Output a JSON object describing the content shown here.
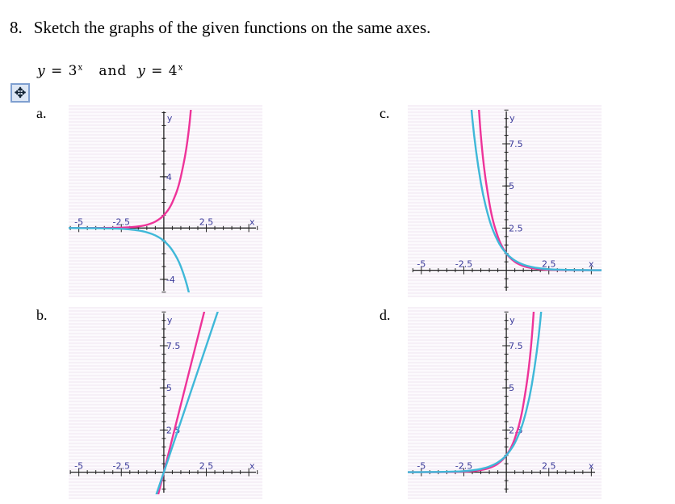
{
  "question": {
    "number": "8.",
    "text": "Sketch the graphs of the given functions on the same axes."
  },
  "equation": {
    "left_y": "y",
    "left_eq": " = 3",
    "left_exp": "x",
    "and": "and",
    "right_y": "y",
    "right_eq": " = 4",
    "right_exp": "x"
  },
  "move_icon": "move-arrows-icon",
  "colors": {
    "pink": "#ee3399",
    "blue": "#3fb8d8",
    "axis": "#222222",
    "label": "#3a3a9a"
  },
  "chart_data": [
    {
      "id": "a",
      "option_label": "a.",
      "type": "line",
      "x_ticks": [
        "-5",
        "-2.5",
        "2.5"
      ],
      "x_tick_values": [
        -5,
        -2.5,
        2.5
      ],
      "y_ticks": [
        "4",
        "-4"
      ],
      "y_tick_values": [
        4,
        -4
      ],
      "xlabel": "x",
      "ylabel": "y",
      "xlim": [
        -5.6,
        5.8
      ],
      "ylim": [
        -5.4,
        9.6
      ],
      "series": [
        {
          "color": "pink",
          "x": [
            -6,
            -5,
            -4,
            -3,
            -2.5,
            -2,
            -1.5,
            -1,
            -0.5,
            0,
            0.5,
            1,
            1.5,
            2
          ],
          "y": [
            0,
            0.001,
            0.004,
            0.016,
            0.031,
            0.063,
            0.125,
            0.25,
            0.5,
            1,
            2,
            4,
            8,
            16
          ]
        },
        {
          "color": "blue",
          "x": [
            -6,
            -5,
            -4,
            -3,
            -2.5,
            -2,
            -1.5,
            -1,
            -0.5,
            0,
            0.5,
            1,
            1.5,
            2,
            2.5
          ],
          "y": [
            0,
            -0.004,
            -0.012,
            -0.037,
            -0.064,
            -0.111,
            -0.192,
            -0.333,
            -0.577,
            -1,
            -1.732,
            -3,
            -5.196,
            -9,
            -15.59
          ]
        }
      ]
    },
    {
      "id": "b",
      "option_label": "b.",
      "type": "line",
      "x_ticks": [
        "-5",
        "-2.5",
        "2.5"
      ],
      "x_tick_values": [
        -5,
        -2.5,
        2.5
      ],
      "y_ticks": [
        "7.5",
        "5",
        "2.5"
      ],
      "y_tick_values": [
        7.5,
        5,
        2.5
      ],
      "xlabel": "x",
      "ylabel": "y",
      "xlim": [
        -5.6,
        5.8
      ],
      "ylim": [
        -1.6,
        9.8
      ],
      "series": [
        {
          "color": "pink",
          "x": [
            -0.4,
            2.6
          ],
          "y": [
            -1.6,
            10.4
          ]
        },
        {
          "color": "blue",
          "x": [
            -0.5,
            3.4
          ],
          "y": [
            -1.5,
            10.2
          ]
        }
      ]
    },
    {
      "id": "c",
      "option_label": "c.",
      "type": "line",
      "x_ticks": [
        "-5",
        "-2.5",
        "2.5"
      ],
      "x_tick_values": [
        -5,
        -2.5,
        2.5
      ],
      "y_ticks": [
        "7.5",
        "5",
        "2.5"
      ],
      "y_tick_values": [
        7.5,
        5,
        2.5
      ],
      "xlabel": "x",
      "ylabel": "y",
      "xlim": [
        -5.8,
        5.6
      ],
      "ylim": [
        -1.6,
        9.8
      ],
      "series": [
        {
          "color": "pink",
          "x": [
            -2,
            -1.5,
            -1,
            -0.5,
            0,
            0.5,
            1,
            1.5,
            2,
            2.5,
            3,
            4,
            5,
            6
          ],
          "y": [
            16,
            8,
            4,
            2,
            1,
            0.5,
            0.25,
            0.125,
            0.063,
            0.031,
            0.016,
            0.004,
            0.001,
            0
          ]
        },
        {
          "color": "blue",
          "x": [
            -2.5,
            -2,
            -1.5,
            -1,
            -0.5,
            0,
            0.5,
            1,
            1.5,
            2,
            2.5,
            3,
            4,
            5,
            6
          ],
          "y": [
            15.59,
            9,
            5.196,
            3,
            1.732,
            1,
            0.577,
            0.333,
            0.192,
            0.111,
            0.064,
            0.037,
            0.012,
            0.004,
            0
          ]
        }
      ]
    },
    {
      "id": "d",
      "option_label": "d.",
      "type": "line",
      "x_ticks": [
        "-5",
        "-2.5",
        "2.5"
      ],
      "x_tick_values": [
        -5,
        -2.5,
        2.5
      ],
      "y_ticks": [
        "7.5",
        "5",
        "2.5"
      ],
      "y_tick_values": [
        7.5,
        5,
        2.5
      ],
      "xlabel": "x",
      "ylabel": "y",
      "xlim": [
        -5.8,
        5.6
      ],
      "ylim": [
        -1.6,
        9.8
      ],
      "series": [
        {
          "color": "pink",
          "x": [
            -6,
            -5,
            -4,
            -3,
            -2.5,
            -2,
            -1.5,
            -1,
            -0.5,
            0,
            0.5,
            1,
            1.5,
            2
          ],
          "y": [
            0,
            0.001,
            0.004,
            0.016,
            0.031,
            0.063,
            0.125,
            0.25,
            0.5,
            1,
            2,
            4,
            8,
            16
          ]
        },
        {
          "color": "blue",
          "x": [
            -6,
            -5,
            -4,
            -3,
            -2.5,
            -2,
            -1.5,
            -1,
            -0.5,
            0,
            0.5,
            1,
            1.5,
            2,
            2.5
          ],
          "y": [
            0,
            0.004,
            0.012,
            0.037,
            0.064,
            0.111,
            0.192,
            0.333,
            0.577,
            1,
            1.732,
            3,
            5.196,
            9,
            15.59
          ]
        }
      ]
    }
  ]
}
